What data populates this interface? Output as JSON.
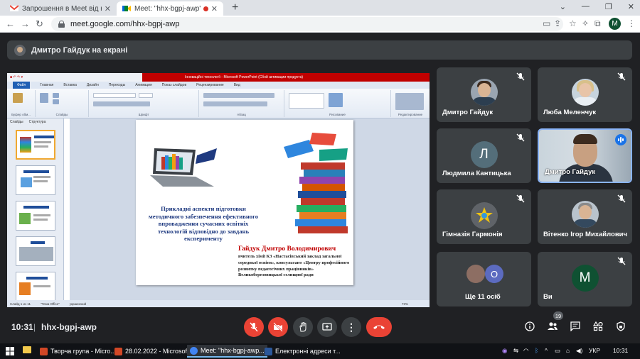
{
  "browser": {
    "tabs": [
      {
        "title": "Запрошення в Meet від корист...",
        "active": false
      },
      {
        "title": "Meet: \"hhx-bgpj-awp\"",
        "active": true
      }
    ],
    "url": "meet.google.com/hhx-bgpj-awp",
    "profile_letter": "M"
  },
  "meet": {
    "presenter_banner": "Дмитро Гайдук на екрані",
    "participants": [
      {
        "name": "Дмитро Гайдук",
        "type": "photo",
        "muted": true
      },
      {
        "name": "Люба Меленчук",
        "type": "photo",
        "muted": true
      },
      {
        "name": "Людмила Кантицька",
        "type": "letter",
        "letter": "Л",
        "color": "#546e7a",
        "muted": true
      },
      {
        "name": "Дмитро Гайдук",
        "type": "video",
        "speaking": true
      },
      {
        "name": "Гімназія Гармонія",
        "type": "logo",
        "muted": true
      },
      {
        "name": "Вітенко Ігор Михайлович",
        "type": "photo",
        "muted": true
      },
      {
        "name": "Ще 11 осіб",
        "type": "more",
        "letter": "О",
        "color": "#5c6bc0"
      },
      {
        "name": "Ви",
        "type": "letter",
        "letter": "M",
        "color": "#0f5132",
        "muted": true
      }
    ],
    "time": "10:31",
    "meeting_code": "hhx-bgpj-awp",
    "people_count": "19"
  },
  "presentation": {
    "window_title": "Інноваційні технології  -  Microsoft PowerPoint (Сбой активации продукта)",
    "ribbon_tabs": [
      "Файл",
      "Главная",
      "Вставка",
      "Дизайн",
      "Переходы",
      "Анимация",
      "Показ слайдов",
      "Рецензирование",
      "Вид"
    ],
    "ribbon_groups": [
      "Буфер обм...",
      "Слайды",
      "Шрифт",
      "Абзац",
      "Рисование",
      "Редактирование"
    ],
    "panel_tabs": [
      "Слайды",
      "Структура"
    ],
    "slide_title": "Прикладні аспекти підготовки методичного забезпечення ефективного впровадження сучасних освітніх технологій відповідно до завдань експерименту",
    "slide_author": "Гайдук Дмитро Володимирович",
    "slide_desc": "вчитель хімії КЗ «Настасівський заклад загальної середньої освіти», консультант «Центру професійного розвитку педагогічних працівників» Великоберезовицької селищної ради",
    "status": [
      "Слайд 1 из 11",
      "\"Тема Office\"",
      "украинский"
    ],
    "zoom": "73%"
  },
  "taskbar": {
    "items": [
      {
        "label": "Творча група - Micro...",
        "color": "#d24726"
      },
      {
        "label": "28.02.2022 - Microsof...",
        "color": "#d24726"
      },
      {
        "label": "Meet: \"hhx-bgpj-awp...",
        "color": "#4285f4"
      },
      {
        "label": "Електронні адреси т...",
        "color": "#2b579a"
      }
    ],
    "lang": "УКР",
    "time": "10:31"
  }
}
